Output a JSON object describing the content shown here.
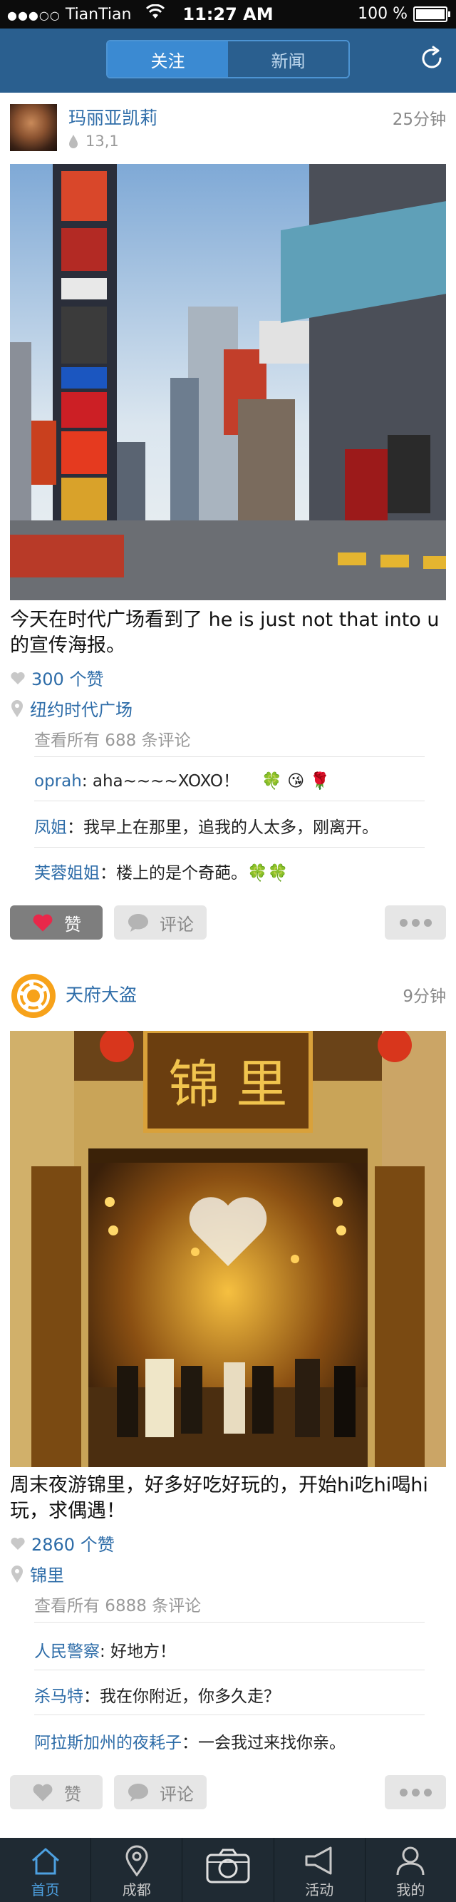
{
  "status_bar": {
    "carrier": "TianTian",
    "time": "11:27 AM",
    "battery": "100 %"
  },
  "nav": {
    "tabs": [
      {
        "label": "关注",
        "active": true
      },
      {
        "label": "新闻",
        "active": false
      }
    ],
    "refresh_icon": "refresh-icon"
  },
  "posts": [
    {
      "user": "玛丽亚凯莉",
      "time": "25分钟",
      "meta_count": "13,1",
      "caption": "今天在时代广场看到了 he is just not that into u 的宣传海报。",
      "likes": "300 个赞",
      "location": "纽约时代广场",
      "all_comments": "查看所有 688 条评论",
      "comments": [
        {
          "who": "oprah",
          "text": ": aha~~~~XOXO！",
          "emoji": "🍀 😘 🌹"
        },
        {
          "who": "凤姐",
          "text": "：我早上在那里，追我的人太多，刚离开。",
          "emoji": ""
        },
        {
          "who": "芙蓉姐姐",
          "text": "：楼上的是个奇葩。",
          "emoji": "🍀🍀"
        }
      ],
      "like_label": "赞",
      "comment_label": "评论",
      "liked": true
    },
    {
      "user": "天府大盗",
      "time": "9分钟",
      "sign_text": "锦 里",
      "caption": "周末夜游锦里，好多好吃好玩的，开始hi吃hi喝hi玩，求偶遇！",
      "likes": "2860 个赞",
      "location": "锦里",
      "all_comments": "查看所有 6888 条评论",
      "comments": [
        {
          "who": "人民警察",
          "text": ": 好地方！",
          "emoji": ""
        },
        {
          "who": "杀马特",
          "text": "：我在你附近，你多久走？",
          "emoji": ""
        },
        {
          "who": "阿拉斯加州的夜耗子",
          "text": "：一会我过来找你亲。",
          "emoji": ""
        }
      ],
      "like_label": "赞",
      "comment_label": "评论",
      "liked": false
    }
  ],
  "tabbar": [
    {
      "label": "首页",
      "icon": "home-icon",
      "active": true
    },
    {
      "label": "成都",
      "icon": "location-pin-icon",
      "active": false
    },
    {
      "label": "",
      "icon": "camera-icon",
      "active": false
    },
    {
      "label": "活动",
      "icon": "megaphone-icon",
      "active": false
    },
    {
      "label": "我的",
      "icon": "person-icon",
      "active": false
    }
  ],
  "colors": {
    "nav_bg": "#2a5f8f",
    "accent": "#2d6ca8",
    "like_red": "#e8284a",
    "tabbar_bg": "#1f2a33"
  }
}
